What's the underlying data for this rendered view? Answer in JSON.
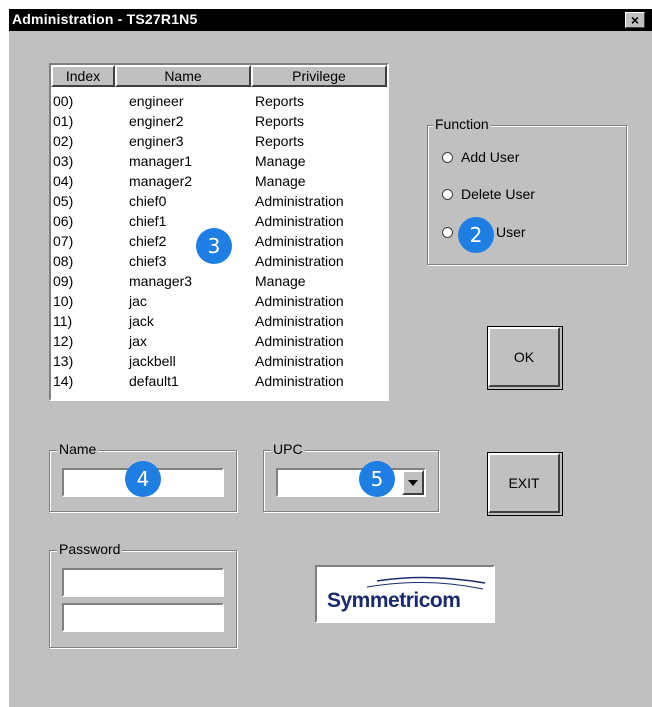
{
  "window": {
    "title": "Administration - TS27R1N5",
    "close_label": "×"
  },
  "list": {
    "headers": [
      "Index",
      "Name",
      "Privilege"
    ],
    "rows": [
      [
        "00)",
        "engineer",
        "Reports"
      ],
      [
        "01)",
        "enginer2",
        "Reports"
      ],
      [
        "02)",
        "enginer3",
        "Reports"
      ],
      [
        "03)",
        "manager1",
        "Manage"
      ],
      [
        "04)",
        "manager2",
        "Manage"
      ],
      [
        "05)",
        "chief0",
        "Administration"
      ],
      [
        "06)",
        "chief1",
        "Administration"
      ],
      [
        "07)",
        "chief2",
        "Administration"
      ],
      [
        "08)",
        "chief3",
        "Administration"
      ],
      [
        "09)",
        "manager3",
        "Manage"
      ],
      [
        "10)",
        "jac",
        "Administration"
      ],
      [
        "11)",
        "jack",
        "Administration"
      ],
      [
        "12)",
        "jax",
        "Administration"
      ],
      [
        "13)",
        "jackbell",
        "Administration"
      ],
      [
        "14)",
        "default1",
        "Administration"
      ]
    ]
  },
  "function_group": {
    "label": "Function",
    "options": [
      "Add User",
      "Delete User",
      "User"
    ]
  },
  "buttons": {
    "ok": "OK",
    "exit": "EXIT"
  },
  "name_group": {
    "label": "Name",
    "value": ""
  },
  "upc_group": {
    "label": "UPC",
    "value": ""
  },
  "password_group": {
    "label": "Password",
    "value1": "",
    "value2": ""
  },
  "logo": {
    "text": "Symmetricom"
  },
  "badges": {
    "b2": "2",
    "b3": "3",
    "b4": "4",
    "b5": "5"
  },
  "colors": {
    "badge": "#1e7ee4",
    "window": "#c0c0c0",
    "titlebar": "#000000"
  }
}
